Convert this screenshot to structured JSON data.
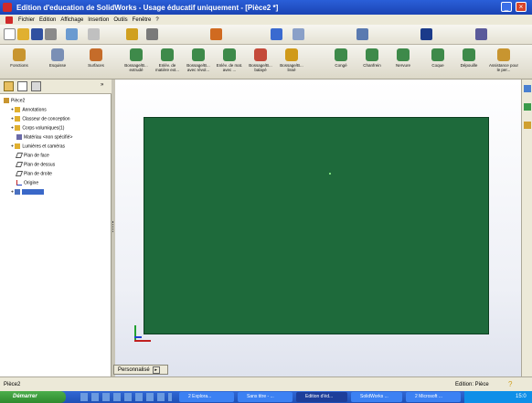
{
  "window": {
    "title": "Edition d'education de SolidWorks - Usage éducatif uniquement - [Pièce2 *]"
  },
  "menu": {
    "items": [
      "Fichier",
      "Edition",
      "Affichage",
      "Insertion",
      "Outils",
      "Fenêtre",
      "?"
    ]
  },
  "command_manager": {
    "items": [
      {
        "label": "Fonctions",
        "icon": "features-icon",
        "color": "#c89530"
      },
      {
        "label": "Esquisse",
        "icon": "sketch-icon",
        "color": "#7a8fb5"
      },
      {
        "label": "Surfaces",
        "icon": "surfaces-icon",
        "color": "#c56c2a"
      },
      {
        "label": "Bossage/B... extrudé",
        "icon": "extrude-boss-icon",
        "color": "#3e8a4a"
      },
      {
        "label": "Enlèv. de matière ext...",
        "icon": "extrude-cut-icon",
        "color": "#3e8a4a"
      },
      {
        "label": "Bossage/B... avec révol...",
        "icon": "revolve-boss-icon",
        "color": "#3e8a4a"
      },
      {
        "label": "Enlèv. de mat. avec ...",
        "icon": "revolve-cut-icon",
        "color": "#3e8a4a"
      },
      {
        "label": "Bossage/B... balayé",
        "icon": "sweep-boss-icon",
        "color": "#c44a3a"
      },
      {
        "label": "Bossage/B... lissé",
        "icon": "loft-boss-icon",
        "color": "#d09a1a"
      },
      {
        "label": "Congé",
        "icon": "fillet-icon",
        "color": "#3e8a4a"
      },
      {
        "label": "Chanfrein",
        "icon": "chamfer-icon",
        "color": "#3e8a4a"
      },
      {
        "label": "Nervure",
        "icon": "rib-icon",
        "color": "#3e8a4a"
      },
      {
        "label": "Coque",
        "icon": "shell-icon",
        "color": "#3e8a4a"
      },
      {
        "label": "Dépouille",
        "icon": "draft-icon",
        "color": "#3e8a4a"
      },
      {
        "label": "Assistance pour le per...",
        "icon": "hole-wizard-icon",
        "color": "#c89530"
      }
    ]
  },
  "feature_tree": {
    "root": "Pièce2",
    "items": [
      {
        "label": "Annotations",
        "icon": "annotations-icon",
        "expand": "+"
      },
      {
        "label": "Classeur de conception",
        "icon": "design-binder-icon",
        "expand": "+"
      },
      {
        "label": "Corps volumiques(1)",
        "icon": "solid-bodies-icon",
        "expand": "+"
      },
      {
        "label": "Matériau <non spécifié>",
        "icon": "material-icon",
        "expand": ""
      },
      {
        "label": "Lumières et caméras",
        "icon": "lights-cameras-icon",
        "expand": "+"
      },
      {
        "label": "Plan de face",
        "icon": "plane-icon",
        "expand": ""
      },
      {
        "label": "Plan de dessus",
        "icon": "plane-icon",
        "expand": ""
      },
      {
        "label": "Plan de droite",
        "icon": "plane-icon",
        "expand": ""
      },
      {
        "label": "Origine",
        "icon": "origin-icon",
        "expand": ""
      },
      {
        "label": "",
        "icon": "extrude-icon",
        "expand": "+"
      }
    ]
  },
  "viewport": {
    "sketch_color": "#1e6a3b",
    "tab_label": "Personnalisé"
  },
  "status": {
    "left": "Pièce2",
    "right": "Edition: Pièce"
  },
  "taskbar": {
    "start": "Démarrer",
    "tasks": [
      "2 Explora...",
      "Sans titre - ...",
      "Edition d'éd...",
      "SolidWorks ...",
      "2 Microsoft ..."
    ],
    "clock": "15:0"
  }
}
